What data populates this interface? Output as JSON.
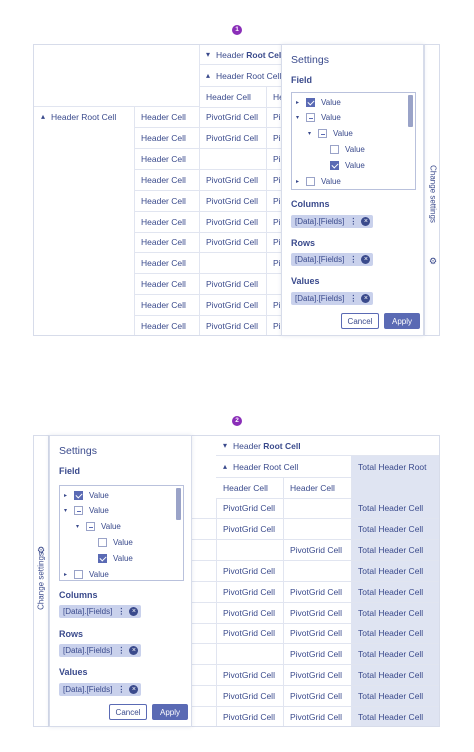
{
  "markers": [
    "1",
    "2"
  ],
  "cells": {
    "header_root": "Header Root Cell",
    "header_prefix": "Header ",
    "root_bold": "Root Cell",
    "header_cell": "Header Cell",
    "pivot_cell": "PivotGrid Cell",
    "pivot_cut": "Pi",
    "header_cut": "He",
    "total_header_root": "Total Header Root",
    "total_header_cell": "Total Header Cell"
  },
  "settings": {
    "title": "Settings",
    "field_label": "Field",
    "columns_label": "Columns",
    "rows_label": "Rows",
    "values_label": "Values",
    "chip_text": "[Data].[Fields]",
    "chip_menu": "⋮",
    "chip_remove": "×",
    "cancel_label": "Cancel",
    "apply_label": "Apply",
    "tab_label": "Change settings",
    "gear_icon": "⚙",
    "tree": [
      {
        "label": "Value",
        "level": 0,
        "arrow": "▸",
        "state": "checked"
      },
      {
        "label": "Value",
        "level": 0,
        "arrow": "▾",
        "state": "partial"
      },
      {
        "label": "Value",
        "level": 1,
        "arrow": "▾",
        "state": "partial"
      },
      {
        "label": "Value",
        "level": 2,
        "arrow": "",
        "state": "unchecked"
      },
      {
        "label": "Value",
        "level": 2,
        "arrow": "",
        "state": "checked"
      },
      {
        "label": "Value",
        "level": 0,
        "arrow": "▸",
        "state": "unchecked"
      }
    ]
  },
  "icons": {
    "expanded": "⌄",
    "collapsed": "⌃",
    "chevron_down": "▾",
    "chevron_up": "▴"
  },
  "grid1_rows": [
    {
      "pivot": true,
      "cut": true
    },
    {
      "pivot": true,
      "cut": true
    },
    {
      "pivot": false,
      "cut": true
    },
    {
      "pivot": true,
      "cut": true
    },
    {
      "pivot": true,
      "cut": true
    },
    {
      "pivot": true,
      "cut": true
    },
    {
      "pivot": true,
      "cut": true
    },
    {
      "pivot": false,
      "cut": true
    },
    {
      "pivot": true,
      "cut": false
    },
    {
      "pivot": true,
      "cut": true
    },
    {
      "pivot": true,
      "cut": true
    }
  ],
  "grid2_rows": [
    {
      "a": true,
      "b": false
    },
    {
      "a": true,
      "b": false
    },
    {
      "a": false,
      "b": true
    },
    {
      "a": true,
      "b": false
    },
    {
      "a": true,
      "b": true
    },
    {
      "a": true,
      "b": true
    },
    {
      "a": true,
      "b": true
    },
    {
      "a": false,
      "b": true
    },
    {
      "a": true,
      "b": true
    },
    {
      "a": true,
      "b": true
    },
    {
      "a": true,
      "b": true
    }
  ]
}
